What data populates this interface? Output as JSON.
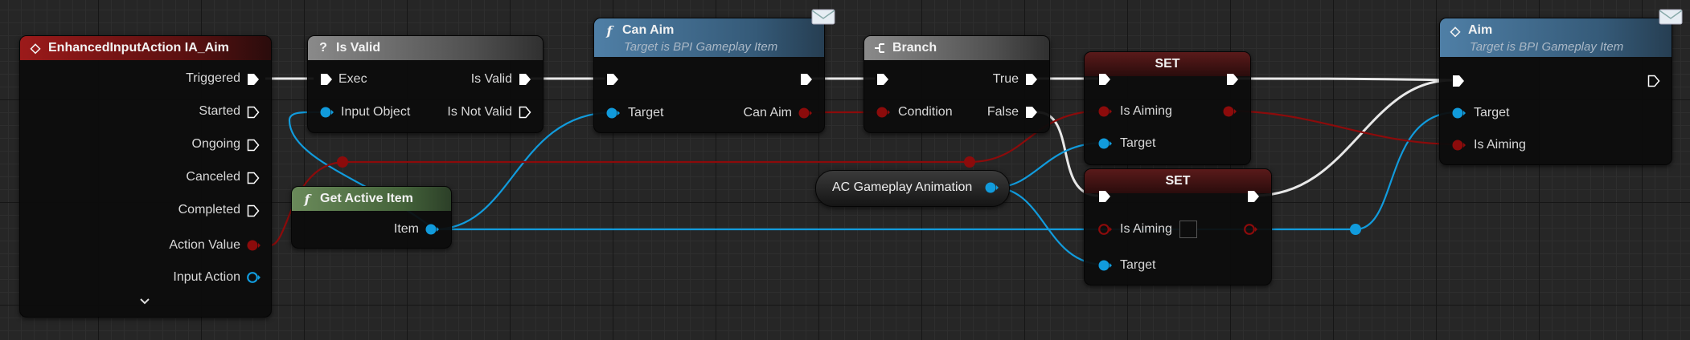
{
  "nodes": {
    "enhanced_input": {
      "title": "EnhancedInputAction IA_Aim",
      "outputs": [
        "Triggered",
        "Started",
        "Ongoing",
        "Canceled",
        "Completed",
        "Action Value",
        "Input Action"
      ]
    },
    "is_valid": {
      "title": "Is Valid",
      "inputs": [
        "Exec",
        "Input Object"
      ],
      "outputs": [
        "Is Valid",
        "Is Not Valid"
      ]
    },
    "get_active_item": {
      "title": "Get Active Item",
      "output": "Item"
    },
    "can_aim": {
      "title": "Can Aim",
      "subtitle": "Target is BPI Gameplay Item",
      "input": "Target",
      "output": "Can Aim"
    },
    "branch": {
      "title": "Branch",
      "input": "Condition",
      "outputs": [
        "True",
        "False"
      ]
    },
    "ac_anim": {
      "title": "AC Gameplay Animation"
    },
    "set_top": {
      "title": "SET",
      "inputs": [
        "Is Aiming",
        "Target"
      ]
    },
    "set_bottom": {
      "title": "SET",
      "inputs": [
        "Is Aiming",
        "Target"
      ]
    },
    "aim": {
      "title": "Aim",
      "subtitle": "Target is BPI Gameplay Item",
      "inputs": [
        "Target",
        "Is Aiming"
      ]
    }
  },
  "colors": {
    "exec_wire": "#ffffff",
    "object_wire": "#119bdc",
    "bool_wire": "#8c0b0b",
    "struct_pin": "#119bdc"
  }
}
